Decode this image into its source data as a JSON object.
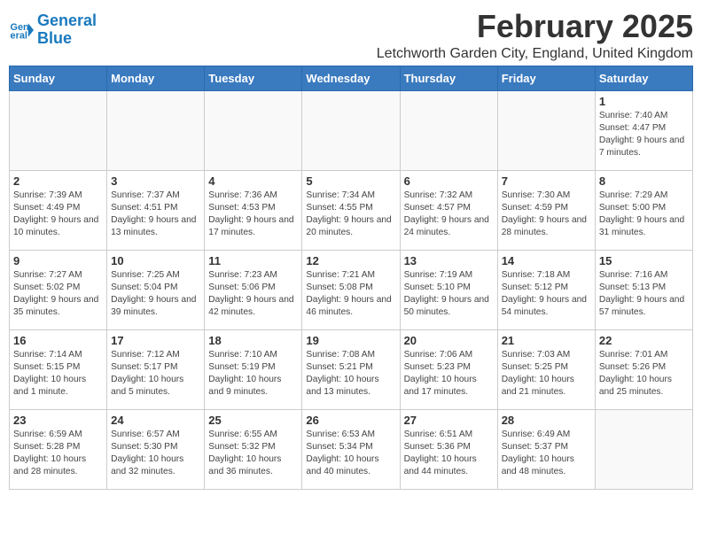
{
  "logo": {
    "line1": "General",
    "line2": "Blue"
  },
  "title": "February 2025",
  "location": "Letchworth Garden City, England, United Kingdom",
  "weekdays": [
    "Sunday",
    "Monday",
    "Tuesday",
    "Wednesday",
    "Thursday",
    "Friday",
    "Saturday"
  ],
  "weeks": [
    [
      {
        "day": "",
        "info": ""
      },
      {
        "day": "",
        "info": ""
      },
      {
        "day": "",
        "info": ""
      },
      {
        "day": "",
        "info": ""
      },
      {
        "day": "",
        "info": ""
      },
      {
        "day": "",
        "info": ""
      },
      {
        "day": "1",
        "info": "Sunrise: 7:40 AM\nSunset: 4:47 PM\nDaylight: 9 hours and 7 minutes."
      }
    ],
    [
      {
        "day": "2",
        "info": "Sunrise: 7:39 AM\nSunset: 4:49 PM\nDaylight: 9 hours and 10 minutes."
      },
      {
        "day": "3",
        "info": "Sunrise: 7:37 AM\nSunset: 4:51 PM\nDaylight: 9 hours and 13 minutes."
      },
      {
        "day": "4",
        "info": "Sunrise: 7:36 AM\nSunset: 4:53 PM\nDaylight: 9 hours and 17 minutes."
      },
      {
        "day": "5",
        "info": "Sunrise: 7:34 AM\nSunset: 4:55 PM\nDaylight: 9 hours and 20 minutes."
      },
      {
        "day": "6",
        "info": "Sunrise: 7:32 AM\nSunset: 4:57 PM\nDaylight: 9 hours and 24 minutes."
      },
      {
        "day": "7",
        "info": "Sunrise: 7:30 AM\nSunset: 4:59 PM\nDaylight: 9 hours and 28 minutes."
      },
      {
        "day": "8",
        "info": "Sunrise: 7:29 AM\nSunset: 5:00 PM\nDaylight: 9 hours and 31 minutes."
      }
    ],
    [
      {
        "day": "9",
        "info": "Sunrise: 7:27 AM\nSunset: 5:02 PM\nDaylight: 9 hours and 35 minutes."
      },
      {
        "day": "10",
        "info": "Sunrise: 7:25 AM\nSunset: 5:04 PM\nDaylight: 9 hours and 39 minutes."
      },
      {
        "day": "11",
        "info": "Sunrise: 7:23 AM\nSunset: 5:06 PM\nDaylight: 9 hours and 42 minutes."
      },
      {
        "day": "12",
        "info": "Sunrise: 7:21 AM\nSunset: 5:08 PM\nDaylight: 9 hours and 46 minutes."
      },
      {
        "day": "13",
        "info": "Sunrise: 7:19 AM\nSunset: 5:10 PM\nDaylight: 9 hours and 50 minutes."
      },
      {
        "day": "14",
        "info": "Sunrise: 7:18 AM\nSunset: 5:12 PM\nDaylight: 9 hours and 54 minutes."
      },
      {
        "day": "15",
        "info": "Sunrise: 7:16 AM\nSunset: 5:13 PM\nDaylight: 9 hours and 57 minutes."
      }
    ],
    [
      {
        "day": "16",
        "info": "Sunrise: 7:14 AM\nSunset: 5:15 PM\nDaylight: 10 hours and 1 minute."
      },
      {
        "day": "17",
        "info": "Sunrise: 7:12 AM\nSunset: 5:17 PM\nDaylight: 10 hours and 5 minutes."
      },
      {
        "day": "18",
        "info": "Sunrise: 7:10 AM\nSunset: 5:19 PM\nDaylight: 10 hours and 9 minutes."
      },
      {
        "day": "19",
        "info": "Sunrise: 7:08 AM\nSunset: 5:21 PM\nDaylight: 10 hours and 13 minutes."
      },
      {
        "day": "20",
        "info": "Sunrise: 7:06 AM\nSunset: 5:23 PM\nDaylight: 10 hours and 17 minutes."
      },
      {
        "day": "21",
        "info": "Sunrise: 7:03 AM\nSunset: 5:25 PM\nDaylight: 10 hours and 21 minutes."
      },
      {
        "day": "22",
        "info": "Sunrise: 7:01 AM\nSunset: 5:26 PM\nDaylight: 10 hours and 25 minutes."
      }
    ],
    [
      {
        "day": "23",
        "info": "Sunrise: 6:59 AM\nSunset: 5:28 PM\nDaylight: 10 hours and 28 minutes."
      },
      {
        "day": "24",
        "info": "Sunrise: 6:57 AM\nSunset: 5:30 PM\nDaylight: 10 hours and 32 minutes."
      },
      {
        "day": "25",
        "info": "Sunrise: 6:55 AM\nSunset: 5:32 PM\nDaylight: 10 hours and 36 minutes."
      },
      {
        "day": "26",
        "info": "Sunrise: 6:53 AM\nSunset: 5:34 PM\nDaylight: 10 hours and 40 minutes."
      },
      {
        "day": "27",
        "info": "Sunrise: 6:51 AM\nSunset: 5:36 PM\nDaylight: 10 hours and 44 minutes."
      },
      {
        "day": "28",
        "info": "Sunrise: 6:49 AM\nSunset: 5:37 PM\nDaylight: 10 hours and 48 minutes."
      },
      {
        "day": "",
        "info": ""
      }
    ]
  ]
}
